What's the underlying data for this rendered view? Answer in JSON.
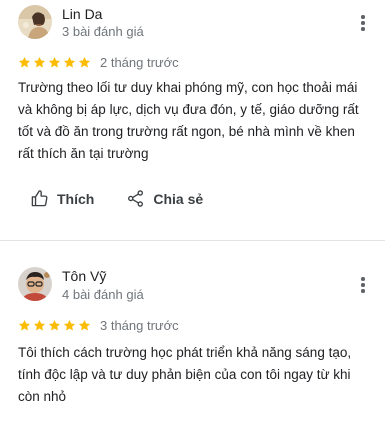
{
  "reviews": [
    {
      "name": "Lin Da",
      "review_count": "3 bài đánh giá",
      "stars": 5,
      "date": "2 tháng trước",
      "text": "Trường theo lối tư duy khai phóng mỹ, con học thoải mái và không bị áp lực, dịch vụ đưa đón, y tế, giáo dưỡng rất tốt và đồ ăn trong trường rất ngon, bé nhà mình về khen rất thích ăn tại trường",
      "actions": {
        "like_label": "Thích",
        "share_label": "Chia sẻ"
      }
    },
    {
      "name": "Tôn Vỹ",
      "review_count": "4 bài đánh giá",
      "stars": 5,
      "date": "3 tháng trước",
      "text": "Tôi thích cách trường học phát triển khả năng sáng tạo, tính độc lập và tư duy phản biện của con tôi ngay từ khi còn nhỏ"
    }
  ],
  "colors": {
    "star": "#fbbc04",
    "secondary_text": "#70757a",
    "primary_text": "#202124"
  },
  "icons": [
    "avatar-photo",
    "more-vert-icon",
    "star-icon",
    "thumb-up-icon",
    "share-icon"
  ]
}
